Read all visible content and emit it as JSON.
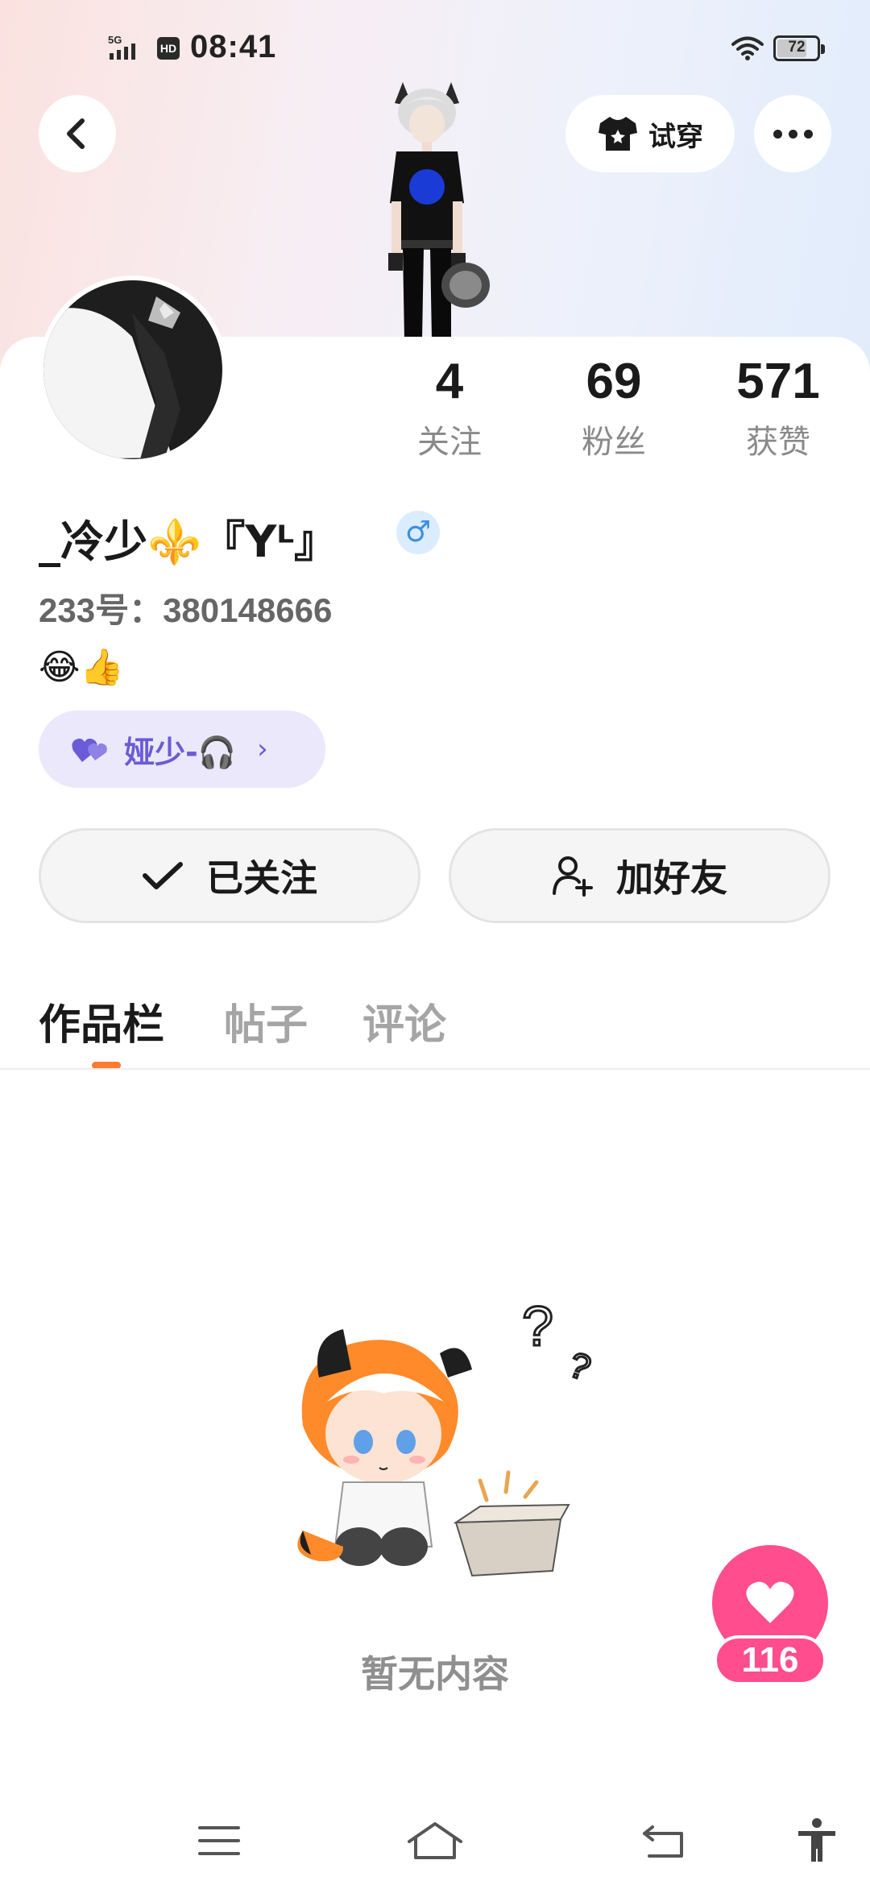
{
  "status_bar": {
    "network": "5G",
    "hd": "HD",
    "time": "08:41",
    "battery": "72"
  },
  "header": {
    "try_on_label": "试穿"
  },
  "stats": [
    {
      "value": "4",
      "label": "关注"
    },
    {
      "value": "69",
      "label": "粉丝"
    },
    {
      "value": "571",
      "label": "获赞"
    }
  ],
  "profile": {
    "username": "_冷少⚜️『Yᴸ』",
    "gender_symbol": "♂",
    "id_text": "233号：380148666",
    "bio": "😂👍",
    "bond_chip_label": "娅少-🎧"
  },
  "actions": {
    "followed_label": "已关注",
    "add_friend_label": "加好友"
  },
  "tabs": [
    {
      "label": "作品栏",
      "active": true
    },
    {
      "label": "帖子",
      "active": false
    },
    {
      "label": "评论",
      "active": false
    }
  ],
  "empty_state": {
    "text": "暂无内容"
  },
  "like_fab": {
    "count": "116"
  },
  "colors": {
    "accent_orange": "#ff7a2e",
    "like_pink": "#ff4d8d",
    "chip_purple": "#6b5bd8",
    "gender_blue": "#3a8fe0"
  },
  "icons": [
    "back-arrow-icon",
    "tshirt-icon",
    "more-dots-icon",
    "checkmark-icon",
    "add-user-icon",
    "heart-icon",
    "menu-icon",
    "home-icon",
    "return-icon",
    "accessibility-icon",
    "wifi-icon",
    "signal-icon",
    "battery-icon"
  ]
}
